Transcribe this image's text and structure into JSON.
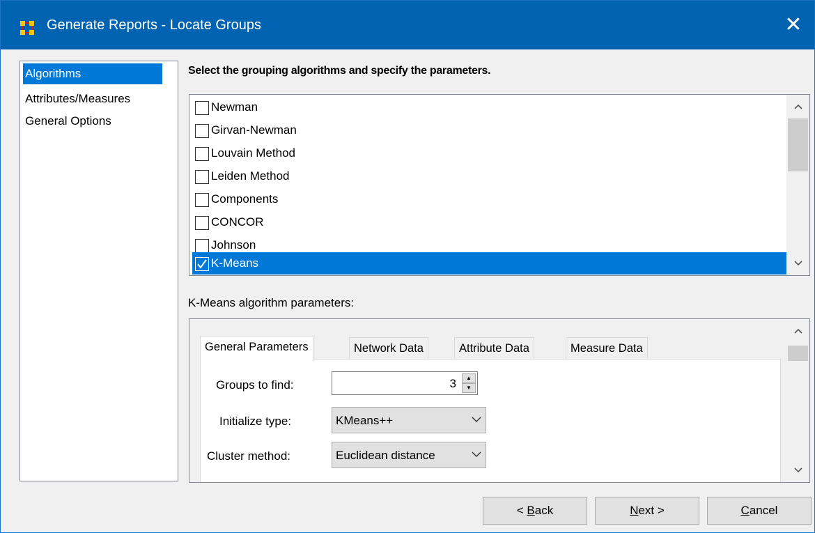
{
  "window": {
    "title": "Generate Reports - Locate Groups",
    "close_glyph": "✕"
  },
  "nav": {
    "items": [
      {
        "label": "Algorithms",
        "selected": true
      },
      {
        "label": "Attributes/Measures",
        "selected": false
      },
      {
        "label": "General Options",
        "selected": false
      }
    ]
  },
  "instruction": "Select the grouping algorithms and specify the parameters.",
  "algorithms": [
    {
      "label": "Newman",
      "checked": false
    },
    {
      "label": "Girvan-Newman",
      "checked": false
    },
    {
      "label": "Louvain Method",
      "checked": false
    },
    {
      "label": "Leiden Method",
      "checked": false
    },
    {
      "label": "Components",
      "checked": false
    },
    {
      "label": "CONCOR",
      "checked": false
    },
    {
      "label": "Johnson",
      "checked": false
    },
    {
      "label": "K-Means",
      "checked": true,
      "selected": true
    }
  ],
  "params": {
    "heading": "K-Means algorithm parameters:",
    "tabs": [
      "General Parameters",
      "Network Data",
      "Attribute Data",
      "Measure Data"
    ],
    "active_tab": "General Parameters",
    "groups_to_find": {
      "label": "Groups to find:",
      "value": "3"
    },
    "initialize_type": {
      "label": "Initialize type:",
      "value": "KMeans++"
    },
    "cluster_method": {
      "label": "Cluster method:",
      "value": "Euclidean distance"
    }
  },
  "buttons": {
    "back": {
      "prefix": "< ",
      "mnemonic": "B",
      "rest": "ack"
    },
    "next": {
      "mnemonic": "N",
      "rest": "ext >"
    },
    "cancel": {
      "mnemonic": "C",
      "rest": "ancel"
    }
  },
  "colors": {
    "titlebar": "#0063b1",
    "selection": "#0078d7"
  }
}
